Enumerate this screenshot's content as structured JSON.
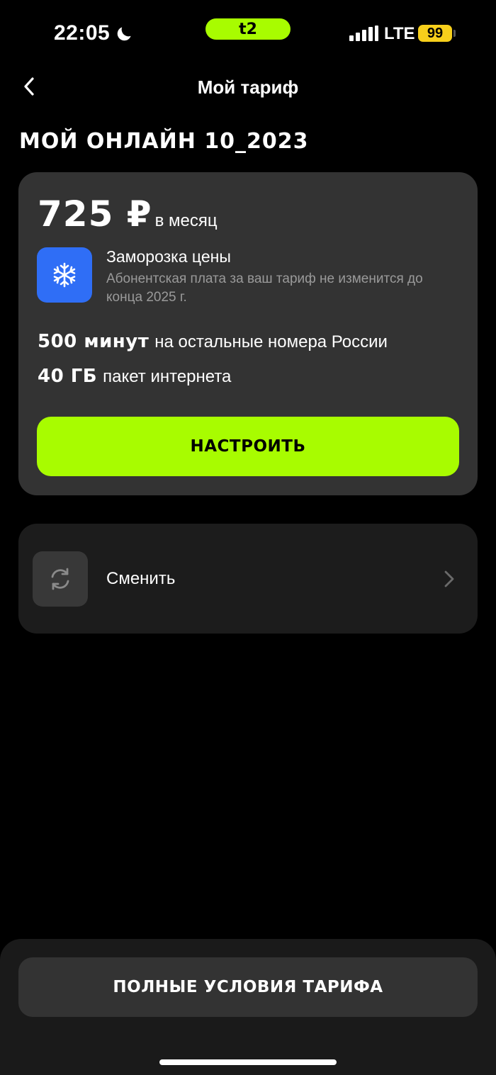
{
  "status_bar": {
    "time": "22:05",
    "carrier": "t2",
    "network": "LTE",
    "battery": "99",
    "carrier_color": "#a8fc00",
    "battery_color": "#f7cf1b"
  },
  "header": {
    "title": "Мой тариф",
    "back_icon": "chevron-left-icon"
  },
  "tariff": {
    "name": "МОЙ ОНЛАЙН 10_2023",
    "price": "725 ₽",
    "price_period": "в месяц",
    "freeze": {
      "icon": "snowflake-icon",
      "title": "Заморозка цены",
      "description": "Абонентская плата за ваш тариф не изменится до конца 2025 г."
    },
    "features": [
      {
        "amount": "500 минут",
        "text": "на остальные номера России"
      },
      {
        "amount": "40 ГБ",
        "text": "пакет интернета"
      }
    ],
    "configure_label": "НАСТРОИТЬ",
    "accent_color": "#a8fc00"
  },
  "change": {
    "icon": "refresh-icon",
    "label": "Сменить",
    "chevron": "chevron-right-icon"
  },
  "bottom": {
    "full_terms_label": "ПОЛНЫЕ УСЛОВИЯ ТАРИФА"
  }
}
